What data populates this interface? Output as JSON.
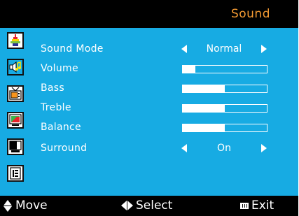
{
  "header": {
    "title": "Sound"
  },
  "colors": {
    "panel": "#17abe3",
    "title_accent": "#f39a33",
    "background": "#000000",
    "text": "#ffffff"
  },
  "sidebar": {
    "items": [
      {
        "name": "picture",
        "icon": "picture-icon",
        "active": false
      },
      {
        "name": "sound",
        "icon": "speaker-icon",
        "active": true
      },
      {
        "name": "channel",
        "icon": "antenna-tv-icon",
        "active": false
      },
      {
        "name": "pc-setting",
        "icon": "pc-display-icon",
        "active": false
      },
      {
        "name": "screen",
        "icon": "screen-icon",
        "active": false
      },
      {
        "name": "setup",
        "icon": "list-icon",
        "active": false
      }
    ]
  },
  "menu": {
    "sound_mode": {
      "label": "Sound Mode",
      "value": "Normal"
    },
    "volume": {
      "label": "Volume",
      "level": 0.15
    },
    "bass": {
      "label": "Bass",
      "level": 0.5
    },
    "treble": {
      "label": "Treble",
      "level": 0.5
    },
    "balance": {
      "label": "Balance",
      "level": 0.5
    },
    "surround": {
      "label": "Surround",
      "value": "On"
    }
  },
  "footer": {
    "move": "Move",
    "select": "Select",
    "exit": "Exit"
  }
}
